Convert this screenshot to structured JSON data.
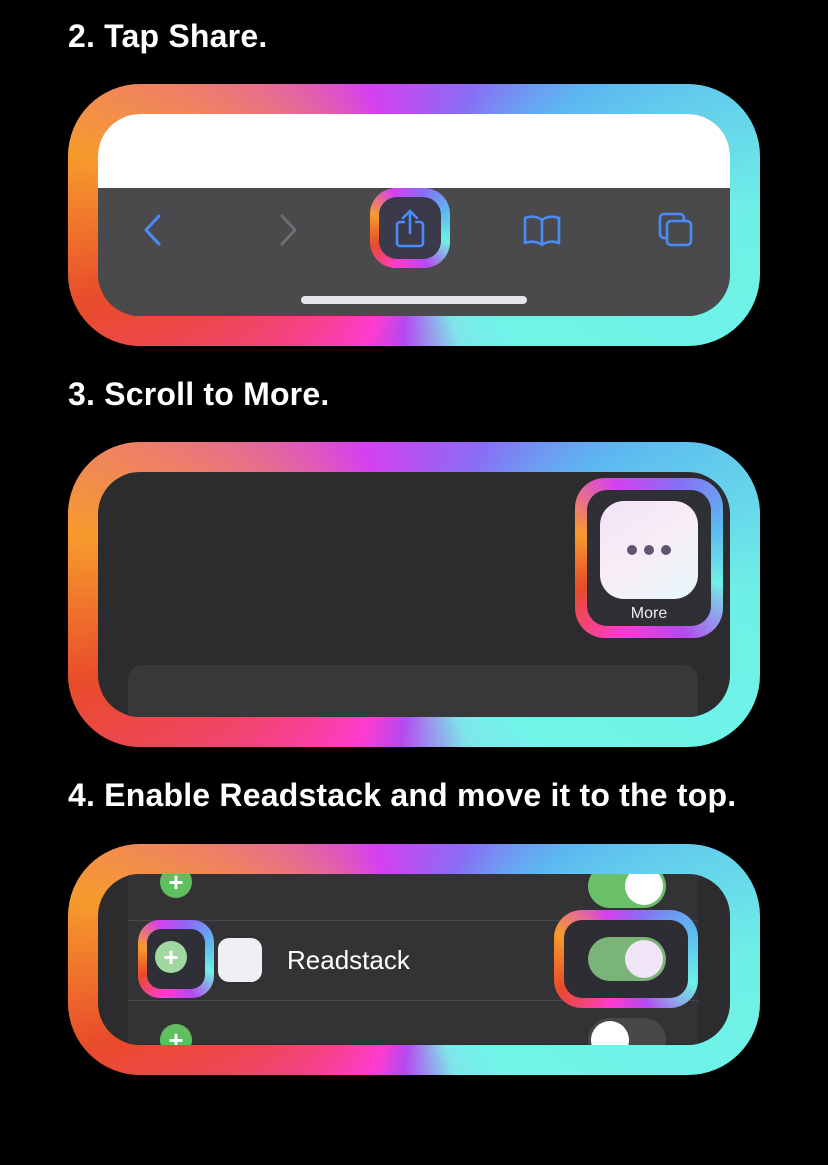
{
  "steps": [
    {
      "title": "2. Tap Share."
    },
    {
      "title": "3. Scroll to More."
    },
    {
      "title": "4. Enable Readstack and move it to the top."
    }
  ],
  "step3": {
    "more_label": "More"
  },
  "step4": {
    "app_name": "Readstack",
    "toggle_state": "on"
  },
  "icons": {
    "step2": [
      "back-chevron-icon",
      "forward-chevron-icon",
      "share-icon",
      "bookmarks-book-icon",
      "tabs-icon"
    ],
    "step3": [
      "more-dots-icon"
    ],
    "step4": [
      "add-plus-icon",
      "toggle-switch"
    ]
  },
  "colors": {
    "background": "#000000",
    "toolbar_icon_blue": "#4a8cf7",
    "toggle_green": "#6abf69",
    "frame_gradient": [
      "#ff3bd0",
      "#e84b2a",
      "#f79b2d",
      "#d640f0",
      "#8a6cf5",
      "#5cb8f0",
      "#6ff0e6"
    ]
  }
}
